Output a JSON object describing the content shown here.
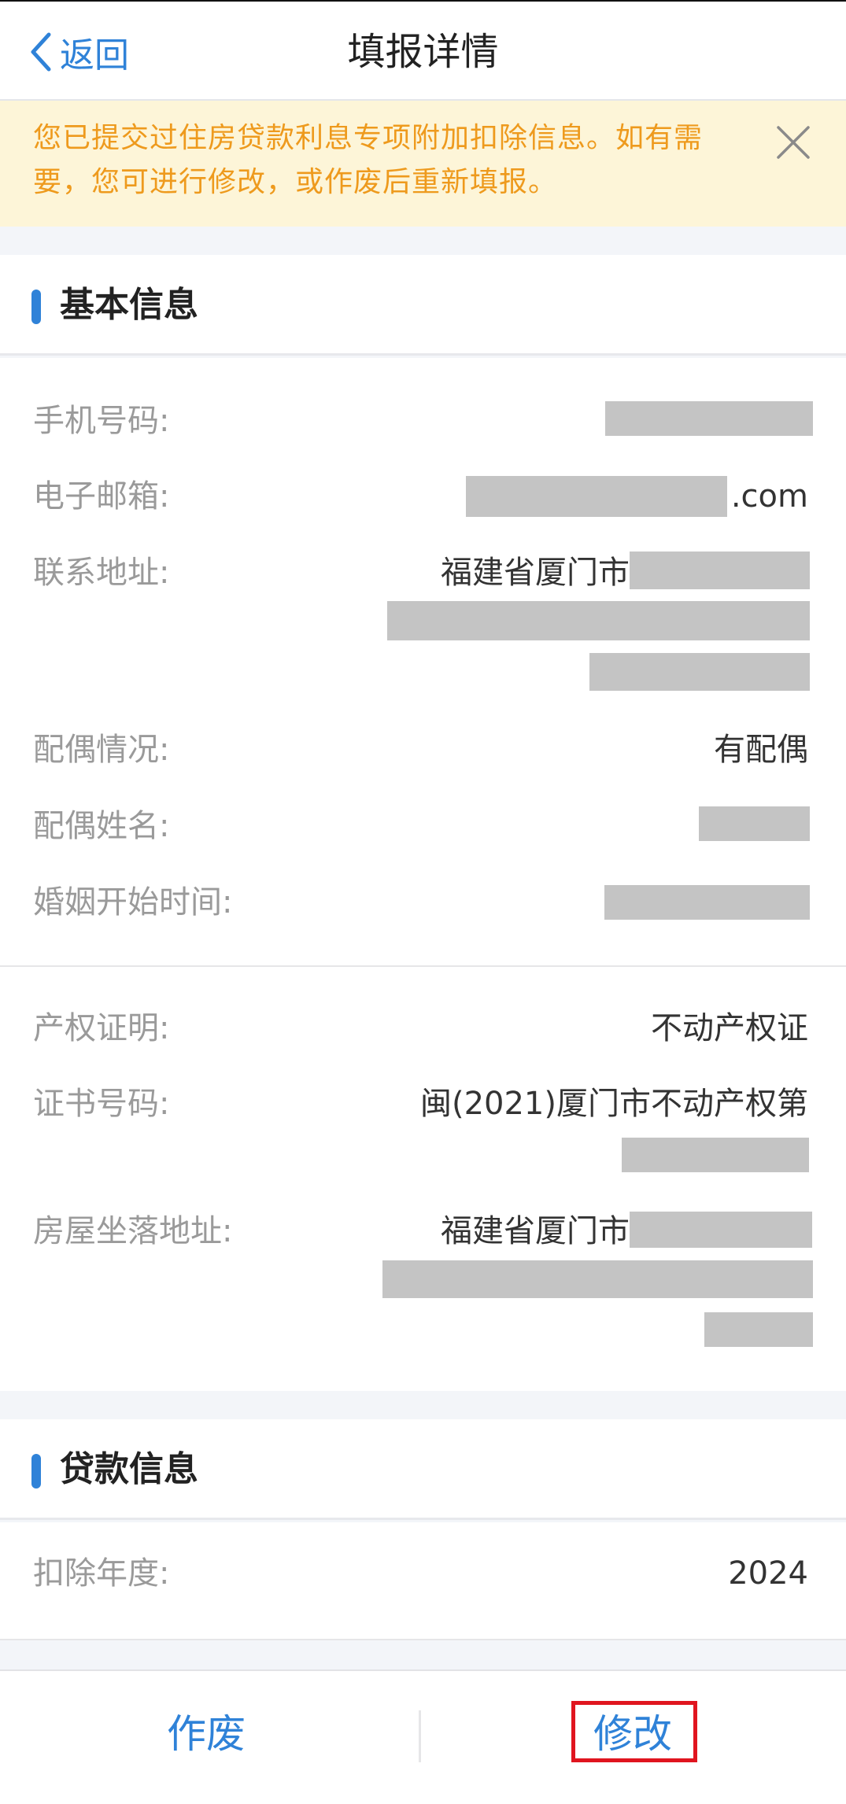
{
  "nav": {
    "back_label": "返回",
    "title": "填报详情"
  },
  "notice": {
    "text": "您已提交过住房贷款利息专项附加扣除信息。如有需要，您可进行修改，或作废后重新填报。"
  },
  "basic": {
    "section_title": "基本信息",
    "phone_label": "手机号码:",
    "email_label": "电子邮箱:",
    "email_suffix": ".com",
    "address_label": "联系地址:",
    "address_prefix": "福建省厦门市",
    "spouse_status_label": "配偶情况:",
    "spouse_status_value": "有配偶",
    "spouse_name_label": "配偶姓名:",
    "marriage_date_label": "婚姻开始时间:",
    "property_proof_label": "产权证明:",
    "property_proof_value": "不动产权证",
    "cert_no_label": "证书号码:",
    "cert_no_value": "闽(2021)厦门市不动产权第",
    "house_address_label": "房屋坐落地址:",
    "house_address_prefix": "福建省厦门市"
  },
  "loan": {
    "section_title": "贷款信息",
    "year_label": "扣除年度:",
    "year_value": "2024"
  },
  "actions": {
    "void_label": "作废",
    "modify_label": "修改"
  },
  "colors": {
    "accent": "#2f82d8",
    "notice_text": "#ee9a1d",
    "notice_bg": "#fdf5d8",
    "highlight": "#e0151f"
  }
}
